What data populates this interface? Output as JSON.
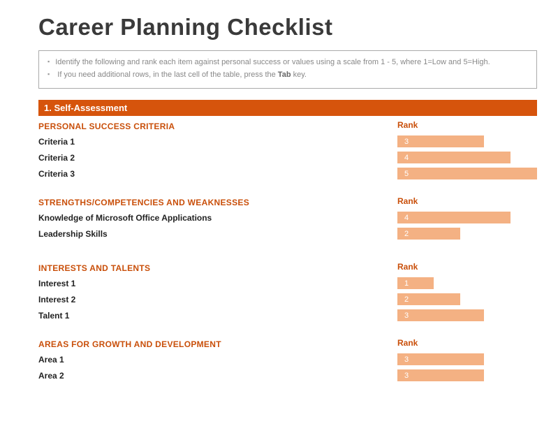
{
  "title": "Career Planning Checklist",
  "instructions": {
    "line1": "Identify the following and rank each item against personal success or values using a scale from 1 - 5, where 1=Low and 5=High.",
    "line2_a": "If you need additional rows, in the last cell of the table, press the ",
    "line2_tab": "Tab",
    "line2_b": " key."
  },
  "sections": {
    "s1": {
      "header": "1. Self-Assessment",
      "rank_label": "Rank",
      "sub1": {
        "title": "PERSONAL SUCCESS CRITERIA",
        "items": [
          {
            "label": "Criteria 1",
            "rank": "3"
          },
          {
            "label": "Criteria 2",
            "rank": "4"
          },
          {
            "label": "Criteria 3",
            "rank": "5"
          }
        ]
      },
      "sub2": {
        "title": "STRENGTHS/COMPETENCIES AND WEAKNESSES",
        "items": [
          {
            "label": "Knowledge of Microsoft Office Applications",
            "rank": "4"
          },
          {
            "label": "Leadership Skills",
            "rank": "2"
          }
        ]
      },
      "sub3": {
        "title": "INTERESTS AND TALENTS",
        "items": [
          {
            "label": "Interest 1",
            "rank": "1"
          },
          {
            "label": "Interest 2",
            "rank": "2"
          },
          {
            "label": "Talent 1",
            "rank": "3"
          }
        ]
      },
      "sub4": {
        "title": "AREAS FOR GROWTH AND DEVELOPMENT",
        "items": [
          {
            "label": "Area 1",
            "rank": "3"
          },
          {
            "label": "Area 2",
            "rank": "3"
          }
        ]
      }
    }
  },
  "bar_widths": {
    "1": "26%",
    "2": "45%",
    "3": "62%",
    "4": "81%",
    "5": "100%"
  }
}
